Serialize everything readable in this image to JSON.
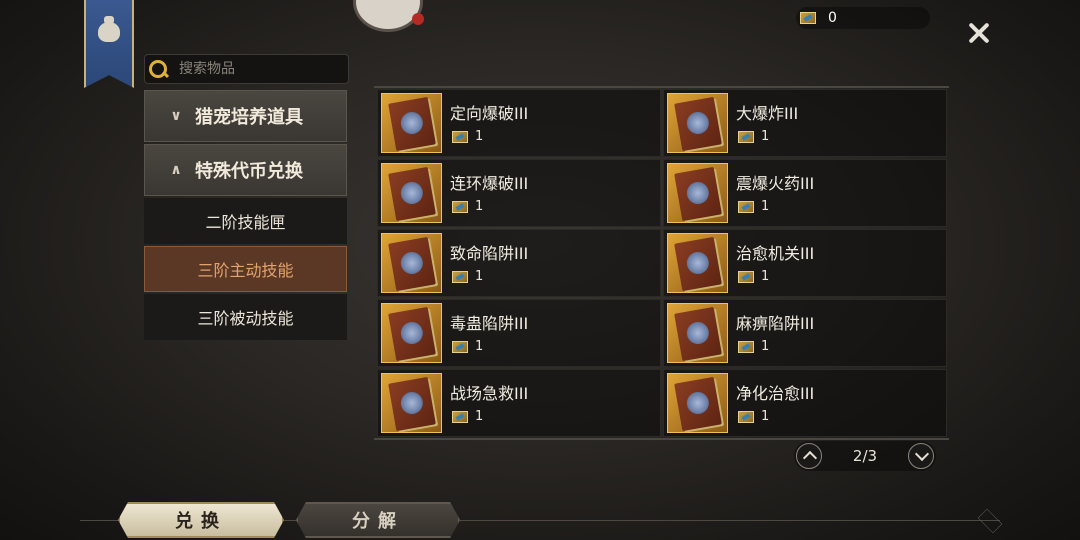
{
  "currency": {
    "amount": "0",
    "icon": "skill-ticket-icon"
  },
  "search": {
    "placeholder": "搜索物品"
  },
  "categories": [
    {
      "label": "猎宠培养道具",
      "state": "collapsed"
    },
    {
      "label": "特殊代币兑换",
      "state": "expanded"
    }
  ],
  "subcategories": [
    {
      "label": "二阶技能匣",
      "active": false
    },
    {
      "label": "三阶主动技能",
      "active": true
    },
    {
      "label": "三阶被动技能",
      "active": false
    }
  ],
  "items": [
    {
      "name": "定向爆破III",
      "cost": "1"
    },
    {
      "name": "大爆炸III",
      "cost": "1"
    },
    {
      "name": "连环爆破III",
      "cost": "1"
    },
    {
      "name": "震爆火药III",
      "cost": "1"
    },
    {
      "name": "致命陷阱III",
      "cost": "1"
    },
    {
      "name": "治愈机关III",
      "cost": "1"
    },
    {
      "name": "毒蛊陷阱III",
      "cost": "1"
    },
    {
      "name": "麻痹陷阱III",
      "cost": "1"
    },
    {
      "name": "战场急救III",
      "cost": "1"
    },
    {
      "name": "净化治愈III",
      "cost": "1"
    }
  ],
  "pager": {
    "text": "2/3"
  },
  "tabs": {
    "exchange": "兑换",
    "decompose": "分解"
  }
}
